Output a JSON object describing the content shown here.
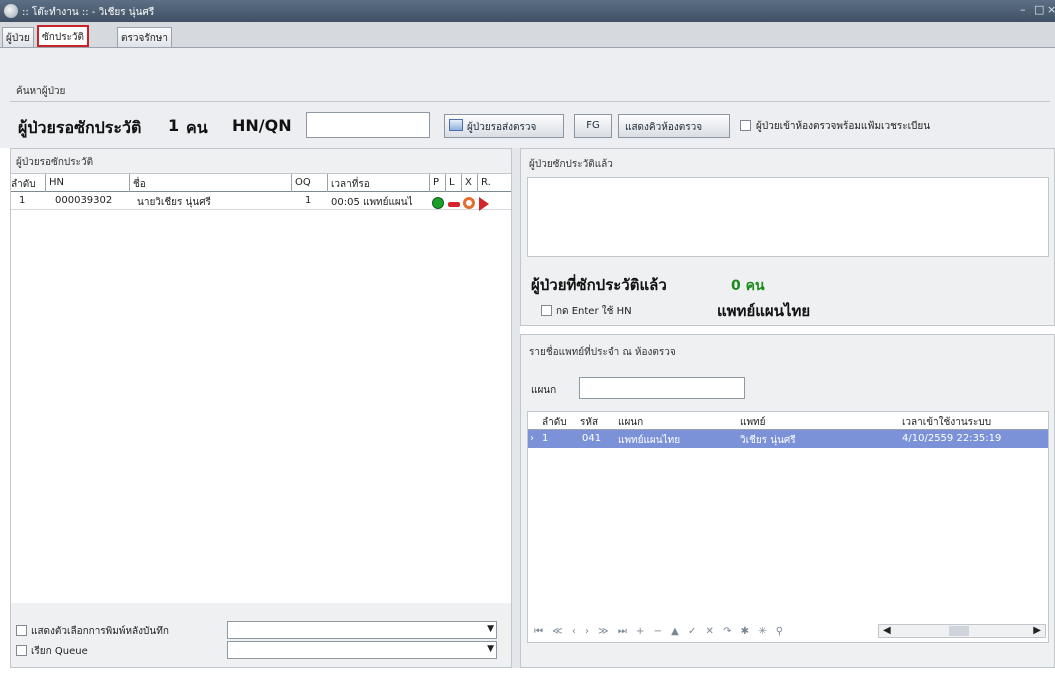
{
  "window": {
    "title": ":: โต๊ะทำงาน :: - วิเชียร นุ่นศรี",
    "minimize": "–",
    "maximize": "□",
    "close": "×"
  },
  "tabs": [
    {
      "label": "ผู้ป่วย"
    },
    {
      "label": "ซักประวัติ"
    },
    {
      "label": "ตรวจรักษา"
    }
  ],
  "search": {
    "section_label": "ค้นหาผู้ป่วย",
    "heading": "ผู้ป่วยรอซักประวัติ",
    "count_value": "1",
    "count_unit": "คน",
    "hnqn_label": "HN/QN",
    "hnqn_value": "",
    "send_button": "ผู้ป่วยรอส่งตรวจ",
    "fg_button": "FG",
    "show_queue_button": "แสดงคิวห้องตรวจ",
    "checkbox_label": "ผู้ป่วยเข้าห้องตรวจพร้อมแฟ้มเวชระเบียน"
  },
  "waiting": {
    "section_label": "ผู้ป่วยรอซักประวัติ",
    "columns": [
      "ลำดับ",
      "HN",
      "ชื่อ",
      "OQ",
      "เวลาที่รอ",
      "P",
      "L",
      "X",
      "R."
    ],
    "rows": [
      {
        "seq": "1",
        "hn": "000039302",
        "name": "นายวิเชียร นุ่นศรี",
        "oq": "1",
        "wait": "00:05 แพทย์แผนไ"
      }
    ],
    "print_option_label": "แสดงตัวเลือกการพิมพ์หลังบันทึก",
    "queue_label": "เรียก Queue"
  },
  "done": {
    "section_label": "ผู้ป่วยซักประวัติแล้ว",
    "heading": "ผู้ป่วยที่ซักประวัติแล้ว",
    "count": "0 คน",
    "enter_hn_label": "กด Enter ใช้ HN",
    "dept_name": "แพทย์แผนไทย"
  },
  "doctors": {
    "section_label": "รายชื่อแพทย์ที่ประจำ ณ ห้องตรวจ",
    "dept_label": "แผนก",
    "dept_value": "",
    "columns": [
      "ลำดับ",
      "รหัส",
      "แผนก",
      "แพทย์",
      "เวลาเข้าใช้งานระบบ"
    ],
    "rows": [
      {
        "seq": "1",
        "code": "041",
        "dept": "แพทย์แผนไทย",
        "doctor": "วิเชียร นุ่นศรี",
        "login": "4/10/2559 22:35:19"
      }
    ],
    "nav_symbols": "⏮ ≪ ‹ › ≫ ⏭ + − ▲ ✓ ✕ ↷ ✱ ✳ ⚲"
  },
  "colors": {
    "selection": "#7b92d8",
    "active_tab_border": "#c8232a",
    "done_count": "#1a8a1a"
  }
}
